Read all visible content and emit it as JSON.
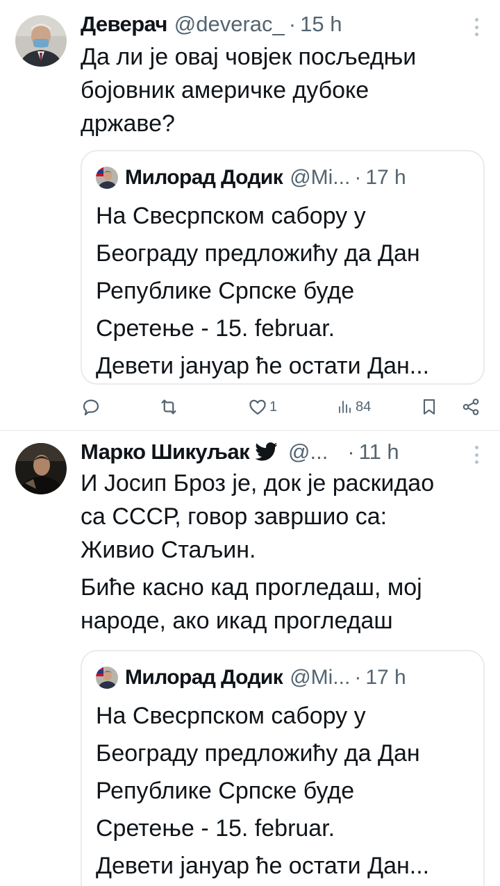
{
  "tweets": [
    {
      "author_name": "Деверач",
      "handle": "@deverac_",
      "dot": "·",
      "time": "15 h",
      "text_lines": [
        "Да ли је овај човјек посљедњи",
        "бојовник америчке дубоке",
        "државе?"
      ],
      "quote": {
        "author_name": "Милорад Додик",
        "handle": "@Mi...",
        "dot": "·",
        "time": "17 h",
        "text_lines": [
          "На Свесрпском сабору у",
          "Београду предложићу да Дан",
          "Републике Српске буде",
          "Сретење - 15. februar.",
          "Девети јануар ће остати Дан..."
        ]
      },
      "actions": {
        "reply_count": "",
        "retweet_count": "",
        "like_count": "1",
        "views_count": "84"
      }
    },
    {
      "author_name": "Марко Шикуљак",
      "handle": "@...",
      "dot": "·",
      "time": "11 h",
      "text_lines": [
        "И Јосип Броз је, док је раскидао",
        "са СССР, говор завршио са:",
        "Живио Стаљин.",
        "Биће касно кад прогледаш, мој",
        "народе, ако икад прогледаш"
      ],
      "quote": {
        "author_name": "Милорад Додик",
        "handle": "@Mi...",
        "dot": "·",
        "time": "17 h",
        "text_lines": [
          "На Свесрпском сабору у",
          "Београду предложићу да Дан",
          "Републике Српске буде",
          "Сретење - 15. februar.",
          "Девети јануар ће остати Дан..."
        ]
      }
    }
  ],
  "colors": {
    "text": "#0f1419",
    "secondary": "#536471",
    "border": "#e6ecf0"
  }
}
